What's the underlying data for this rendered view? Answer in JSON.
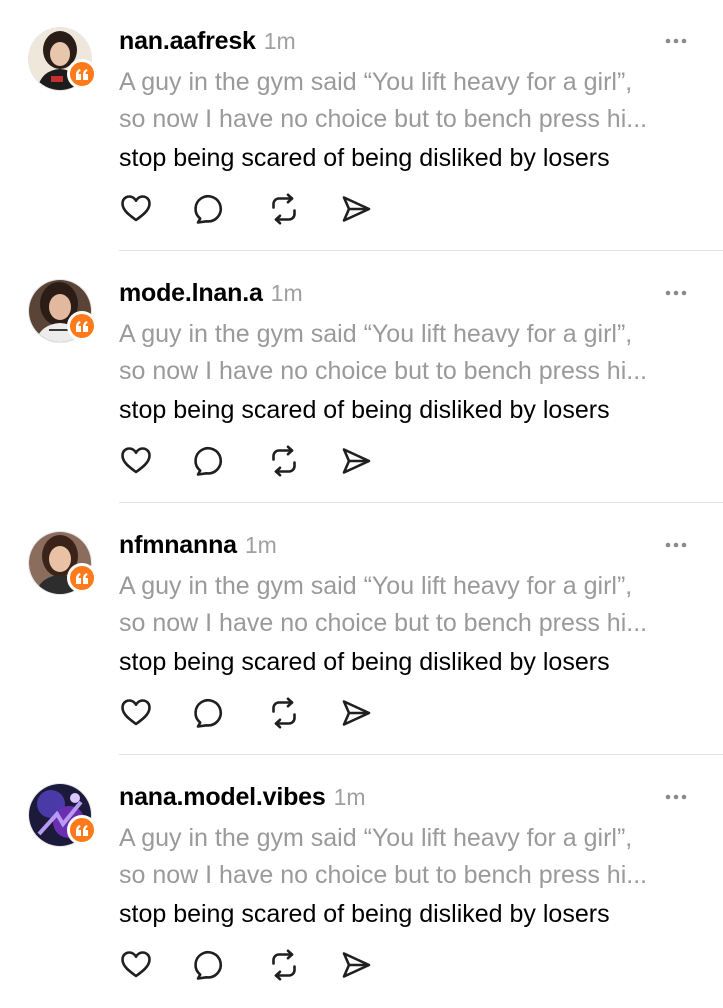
{
  "colors": {
    "badge": "#ff7a1a",
    "muted_text": "#9a9a9a",
    "timestamp": "#a0a0a0",
    "divider": "#e3e3e3"
  },
  "icons": {
    "badge": "quote-icon",
    "more": "more-options-icon",
    "actions": [
      "heart-icon",
      "comment-icon",
      "repost-icon",
      "share-icon"
    ]
  },
  "posts": [
    {
      "username": "nan.aafresk",
      "time": "1m",
      "quote_line_1": "A guy in the gym said “You lift heavy for a girl”,",
      "quote_line_2": "so now I have no choice but to bench press hi...",
      "text": "stop being scared of being disliked by losers"
    },
    {
      "username": "mode.lnan.a",
      "time": "1m",
      "quote_line_1": "A guy in the gym said “You lift heavy for a girl”,",
      "quote_line_2": "so now I have no choice but to bench press hi...",
      "text": "stop being scared of being disliked by losers"
    },
    {
      "username": "nfmnanna",
      "time": "1m",
      "quote_line_1": "A guy in the gym said “You lift heavy for a girl”,",
      "quote_line_2": "so now I have no choice but to bench press hi...",
      "text": "stop being scared of being disliked by losers"
    },
    {
      "username": "nana.model.vibes",
      "time": "1m",
      "quote_line_1": "A guy in the gym said “You lift heavy for a girl”,",
      "quote_line_2": "so now I have no choice but to bench press hi...",
      "text": "stop being scared of being disliked by losers"
    }
  ]
}
